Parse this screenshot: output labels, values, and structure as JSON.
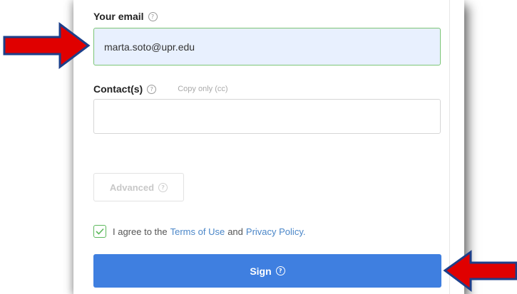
{
  "email_field": {
    "label": "Your email",
    "value": "marta.soto@upr.edu"
  },
  "contacts_field": {
    "label": "Contact(s)",
    "hint": "Copy only (cc)",
    "value": ""
  },
  "advanced_button": {
    "label": "Advanced"
  },
  "agreement": {
    "checked": true,
    "prefix": "I agree to the",
    "terms_link": "Terms of Use",
    "conjunction": "and",
    "privacy_link": "Privacy Policy."
  },
  "sign_button": {
    "label": "Sign"
  },
  "help_icon_glyph": "?",
  "colors": {
    "arrow_fill": "#e00000",
    "arrow_outline": "#1d3f8a",
    "sign_button": "#3f7fe0",
    "email_field_bg": "#e8f0fe",
    "link": "#4a86c8"
  }
}
